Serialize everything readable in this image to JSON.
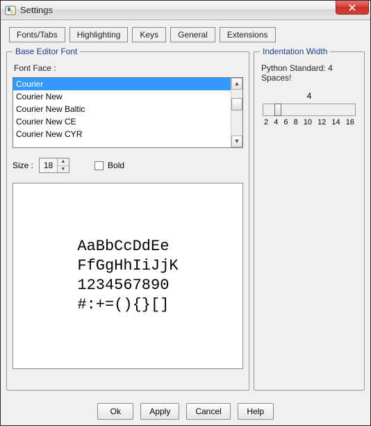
{
  "title": "Settings",
  "tabs": [
    "Fonts/Tabs",
    "Highlighting",
    "Keys",
    "General",
    "Extensions"
  ],
  "base_font": {
    "legend": "Base Editor Font",
    "face_label": "Font Face :",
    "fonts": [
      "Courier",
      "Courier New",
      "Courier New Baltic",
      "Courier New CE",
      "Courier New CYR"
    ],
    "selected_index": 0,
    "size_label": "Size :",
    "size_value": "18",
    "bold_label": "Bold",
    "bold_checked": false,
    "preview": "AaBbCcDdEe\nFfGgHhIiJjK\n1234567890\n#:+=(){}[]"
  },
  "indentation": {
    "legend": "Indentation Width",
    "note": "Python Standard: 4 Spaces!",
    "value": "4",
    "ticks": [
      "2",
      "4",
      "6",
      "8",
      "10",
      "12",
      "14",
      "16"
    ]
  },
  "buttons": {
    "ok": "Ok",
    "apply": "Apply",
    "cancel": "Cancel",
    "help": "Help"
  }
}
